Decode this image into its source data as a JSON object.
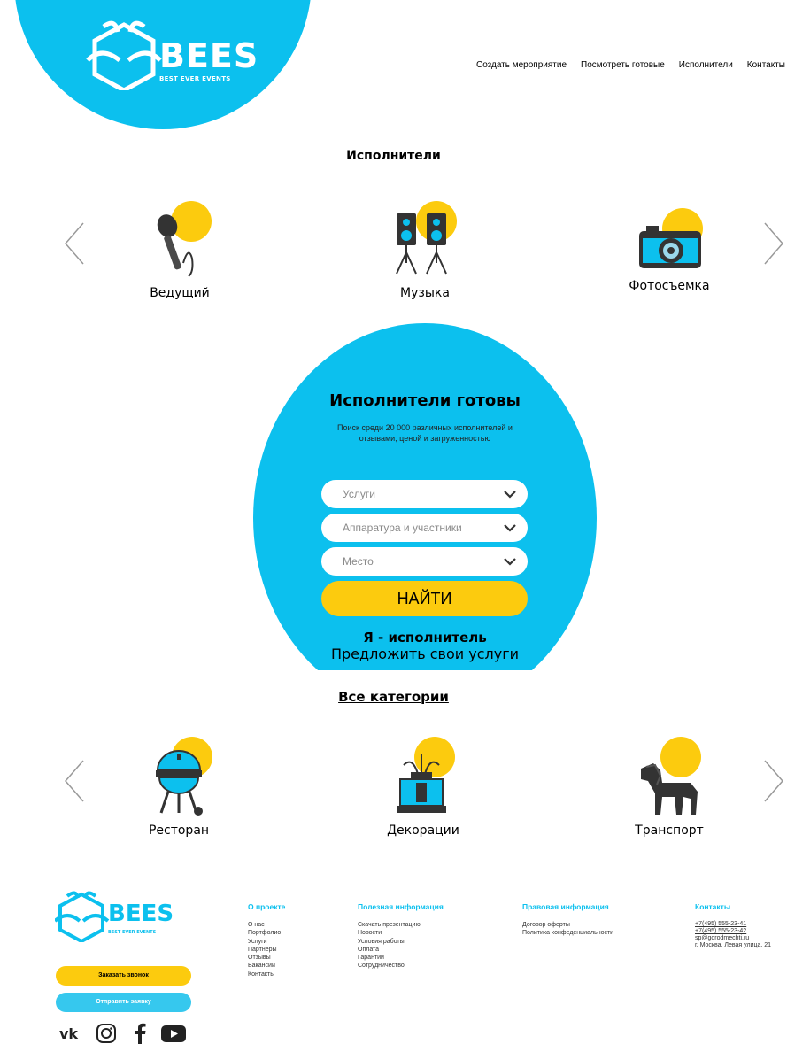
{
  "header": {
    "logo_text": "BEES",
    "logo_sub": "BEST EVER EVENTS",
    "nav": [
      "Создать мероприятие",
      "Посмотреть готовые",
      "Исполнители",
      "Контакты"
    ]
  },
  "performers": {
    "title": "Исполнители",
    "items": [
      {
        "label": "Ведущий",
        "icon": "microphone-icon"
      },
      {
        "label": "Музыка",
        "icon": "speakers-icon"
      },
      {
        "label": "Фотосъемка",
        "icon": "camera-icon"
      }
    ]
  },
  "search": {
    "title": "Исполнители готовы",
    "description": "Поиск среди 20 000 различных исполнителей и отзывами, ценой и загруженностью",
    "selects": [
      "Услуги",
      "Аппаратура и участники",
      "Место"
    ],
    "find_label": "НАЙТИ",
    "performer_label": "Я - исполнитель",
    "offer_label": "Предложить свои услуги"
  },
  "categories": {
    "all_label": "Все категории",
    "items": [
      {
        "label": "Ресторан",
        "icon": "grill-icon"
      },
      {
        "label": "Декорации",
        "icon": "fountain-icon"
      },
      {
        "label": "Транспорт",
        "icon": "horse-icon"
      }
    ]
  },
  "colors": {
    "accent": "#0cc0ee",
    "yellow": "#fccb0e"
  },
  "footer": {
    "logo_text": "BEES",
    "logo_sub": "BEST EVER EVENTS",
    "call_button": "Заказать звонок",
    "request_button": "Отправить заявку",
    "columns": [
      {
        "title": "О проекте",
        "links": [
          "О нас",
          "Портфолио",
          "Услуги",
          "Партнеры",
          "Отзывы",
          "Вакансии",
          "Контакты"
        ]
      },
      {
        "title": "Полезная информация",
        "links": [
          "Скачать презентацию",
          "Новости",
          "Условия работы",
          "Оплата",
          "Гарантии",
          "Сотрудничество"
        ]
      },
      {
        "title": "Правовая информация",
        "links": [
          "Договор оферты",
          "Политика конфеденциальности"
        ]
      },
      {
        "title": "Контакты",
        "links": [
          "+7(495) 555-23-41",
          "+7(495) 555-23-42",
          "sp@gorodmechti.ru",
          "г. Москва, Левая улица, 21"
        ]
      }
    ],
    "social": [
      "vk-icon",
      "instagram-icon",
      "facebook-icon",
      "youtube-icon"
    ]
  }
}
